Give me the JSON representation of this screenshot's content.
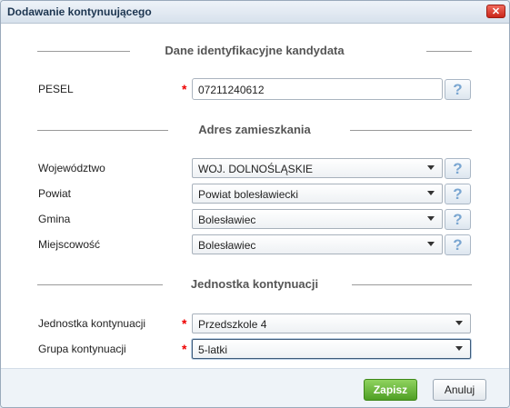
{
  "dialog": {
    "title": "Dodawanie kontynuującego",
    "close_label": "✕"
  },
  "sections": {
    "identity": "Dane identyfikacyjne kandydata",
    "address": "Adres zamieszkania",
    "unit": "Jednostka kontynuacji"
  },
  "fields": {
    "pesel": {
      "label": "PESEL",
      "required": "*",
      "value": "07211240612",
      "help": "?"
    },
    "wojewodztwo": {
      "label": "Województwo",
      "value": "WOJ. DOLNOŚLĄSKIE",
      "help": "?"
    },
    "powiat": {
      "label": "Powiat",
      "value": "Powiat bolesławiecki",
      "help": "?"
    },
    "gmina": {
      "label": "Gmina",
      "value": "Bolesławiec",
      "help": "?"
    },
    "miejscowosc": {
      "label": "Miejscowość",
      "value": "Bolesławiec",
      "help": "?"
    },
    "jednostka": {
      "label": "Jednostka kontynuacji",
      "required": "*",
      "value": "Przedszkole 4"
    },
    "grupa": {
      "label": "Grupa kontynuacji",
      "required": "*",
      "value": "5-latki"
    }
  },
  "footer": {
    "save_label": "Zapisz",
    "cancel_label": "Anuluj"
  },
  "colors": {
    "save_button": "#5fae33",
    "required_marker": "#ee0000",
    "help_icon": "#7aa6d1"
  }
}
